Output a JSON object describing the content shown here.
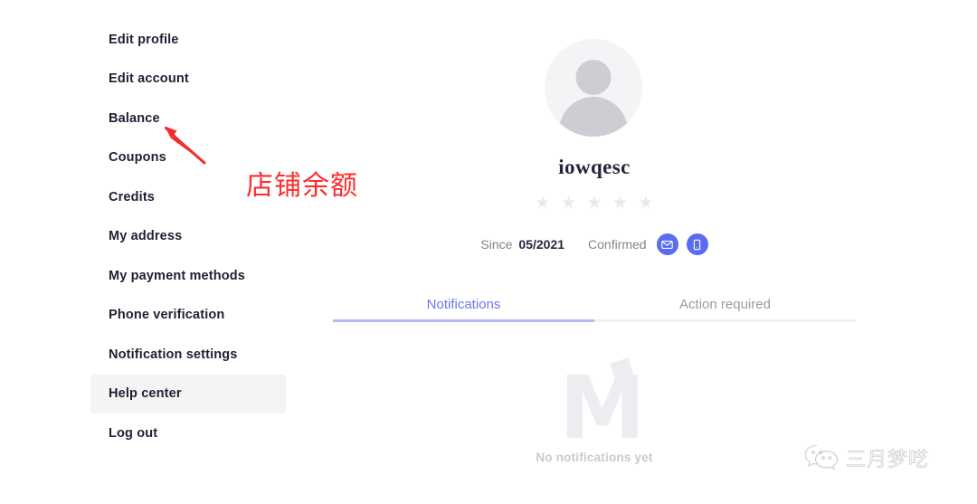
{
  "sidebar": {
    "items": [
      {
        "label": "Edit profile",
        "active": false
      },
      {
        "label": "Edit account",
        "active": false
      },
      {
        "label": "Balance",
        "active": false
      },
      {
        "label": "Coupons",
        "active": false
      },
      {
        "label": "Credits",
        "active": false
      },
      {
        "label": "My address",
        "active": false
      },
      {
        "label": "My payment methods",
        "active": false
      },
      {
        "label": "Phone verification",
        "active": false
      },
      {
        "label": "Notification settings",
        "active": false
      },
      {
        "label": "Help center",
        "active": true
      },
      {
        "label": "Log out",
        "active": false
      }
    ]
  },
  "profile": {
    "avatar_icon": "user-placeholder-icon",
    "username": "iowqesc",
    "rating": {
      "stars_total": 5,
      "stars_filled": 0,
      "star_glyph": "★",
      "empty_color": "#e9eaee"
    },
    "since_label": "Since",
    "since_value": "05/2021",
    "confirmed_label": "Confirmed",
    "badges": [
      {
        "name": "email-verified-badge",
        "icon": "envelope-icon"
      },
      {
        "name": "phone-verified-badge",
        "icon": "mobile-phone-icon"
      }
    ],
    "badge_color": "#5a6cf0"
  },
  "tabs": [
    {
      "label": "Notifications",
      "active": true
    },
    {
      "label": "Action required",
      "active": false
    }
  ],
  "tab_accent_color": "#6f74ec",
  "empty_state": {
    "logo_icon": "mercari-m-logo",
    "message": "No notifications yet"
  },
  "annotation": {
    "text": "店铺余额",
    "color": "#fc2d2d",
    "arrow_target": "Balance"
  },
  "watermark": {
    "icon": "wechat-icon",
    "text": "三月梦呓"
  }
}
